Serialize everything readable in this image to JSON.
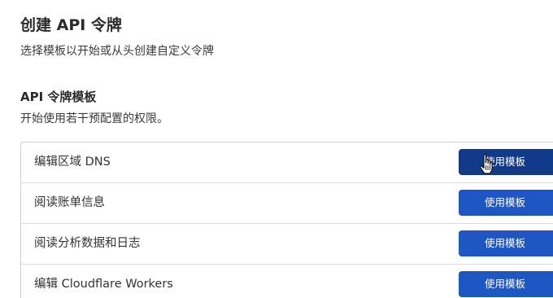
{
  "header": {
    "title": "创建 API 令牌",
    "subtitle": "选择模板以开始或从头创建自定义令牌"
  },
  "templates_section": {
    "title": "API 令牌模板",
    "description": "开始使用若干预配置的权限。",
    "items": [
      {
        "name": "编辑区域 DNS",
        "button_label": "使用模板",
        "hovered": true
      },
      {
        "name": "阅读账单信息",
        "button_label": "使用模板",
        "hovered": false
      },
      {
        "name": "阅读分析数据和日志",
        "button_label": "使用模板",
        "hovered": false
      },
      {
        "name": "编辑 Cloudflare Workers",
        "button_label": "使用模板",
        "hovered": false
      }
    ]
  },
  "colors": {
    "button": "#1e56c4",
    "button_hover": "#123a8a"
  },
  "icons": {
    "cursor": "hand-pointer-icon"
  }
}
